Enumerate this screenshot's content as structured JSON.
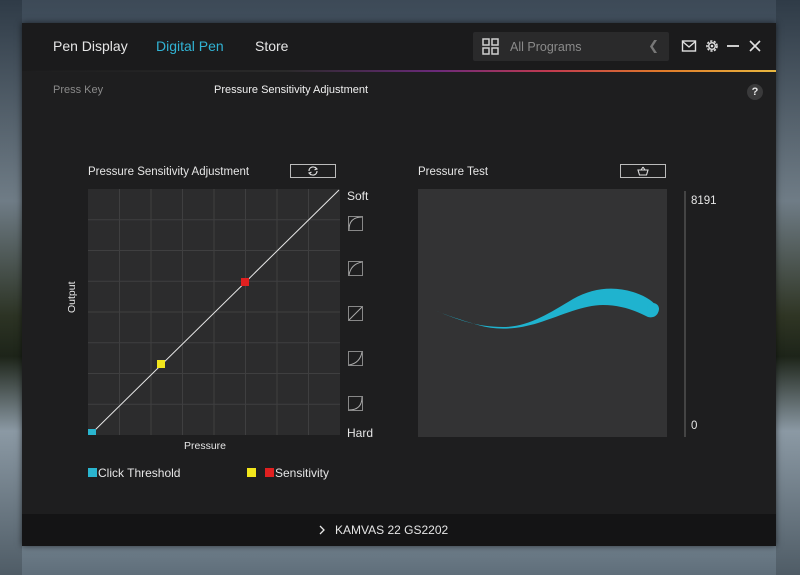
{
  "nav": {
    "tabs": [
      {
        "label": "Pen Display"
      },
      {
        "label": "Digital Pen"
      },
      {
        "label": "Store"
      }
    ],
    "active_tab": "Digital Pen"
  },
  "programs": {
    "label": "All Programs"
  },
  "subnav": {
    "items": [
      {
        "label": "Press Key"
      },
      {
        "label": "Pressure Sensitivity Adjustment"
      }
    ],
    "help": "?"
  },
  "pressure_adjust": {
    "title": "Pressure Sensitivity Adjustment",
    "soft": "Soft",
    "hard": "Hard",
    "xlabel": "Pressure",
    "ylabel": "Output",
    "points": {
      "click_threshold": {
        "x": 0,
        "y": 0
      },
      "sensitivity_low": {
        "x": 0.29,
        "y": 0.29
      },
      "sensitivity_high": {
        "x": 0.62,
        "y": 0.62
      }
    }
  },
  "pressure_test": {
    "title": "Pressure Test",
    "max": "8191",
    "min": "0"
  },
  "legend": {
    "click_threshold": "Click Threshold",
    "sensitivity": "Sensitivity"
  },
  "footer": {
    "device": "KAMVAS 22 GS2202"
  },
  "colors": {
    "accent": "#31b3d4",
    "click_threshold": "#2ab5cf",
    "sensitivity_yellow": "#f2e61c",
    "sensitivity_red": "#e02020",
    "stroke": "#1fb3cf"
  }
}
